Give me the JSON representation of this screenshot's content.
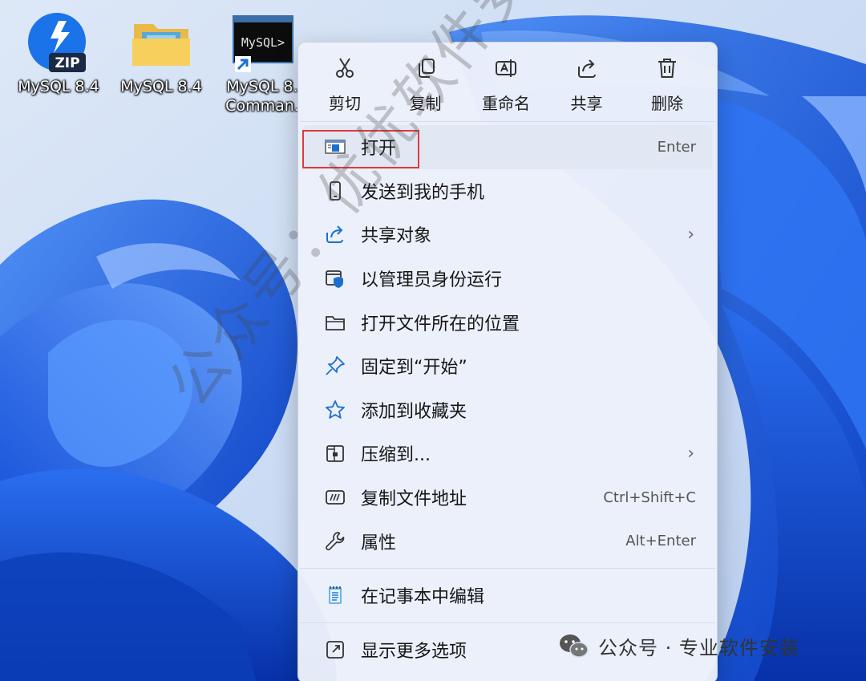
{
  "desktop": {
    "icons": [
      {
        "label": "MySQL 8.4",
        "icon": "zip-archive-icon",
        "badge": "ZIP"
      },
      {
        "label": "MySQL 8.4",
        "icon": "folder-icon"
      },
      {
        "label": "MySQL 8.\nComman.",
        "icon": "mysql-console-icon",
        "badge": "MySQL>"
      }
    ]
  },
  "context_menu": {
    "top_actions": [
      {
        "label": "剪切",
        "icon": "scissors-icon"
      },
      {
        "label": "复制",
        "icon": "copy-icon"
      },
      {
        "label": "重命名",
        "icon": "rename-icon"
      },
      {
        "label": "共享",
        "icon": "share-icon"
      },
      {
        "label": "删除",
        "icon": "trash-icon"
      }
    ],
    "items": [
      {
        "label": "打开",
        "icon": "app-window-icon",
        "shortcut": "Enter",
        "highlighted": true
      },
      {
        "label": "发送到我的手机",
        "icon": "phone-icon"
      },
      {
        "label": "共享对象",
        "icon": "share-icon",
        "submenu": true
      },
      {
        "label": "以管理员身份运行",
        "icon": "admin-shield-icon"
      },
      {
        "label": "打开文件所在的位置",
        "icon": "folder-icon"
      },
      {
        "label": "固定到“开始”",
        "icon": "pin-icon"
      },
      {
        "label": "添加到收藏夹",
        "icon": "star-icon"
      },
      {
        "label": "压缩到...",
        "icon": "archive-icon",
        "submenu": true
      },
      {
        "label": "复制文件地址",
        "icon": "copy-path-icon",
        "shortcut": "Ctrl+Shift+C"
      },
      {
        "label": "属性",
        "icon": "wrench-icon",
        "shortcut": "Alt+Enter"
      },
      {
        "label": "在记事本中编辑",
        "icon": "notepad-icon"
      },
      {
        "label": "显示更多选项",
        "icon": "more-options-icon"
      }
    ],
    "submenu_arrow": "›"
  },
  "watermark": "公众号：优优软件安装",
  "credit": "公众号 · 专业软件安装",
  "colors": {
    "highlight_border": "#e0393b",
    "icon_blue": "#1a6fd1",
    "menu_background": "#ecf1fa"
  }
}
